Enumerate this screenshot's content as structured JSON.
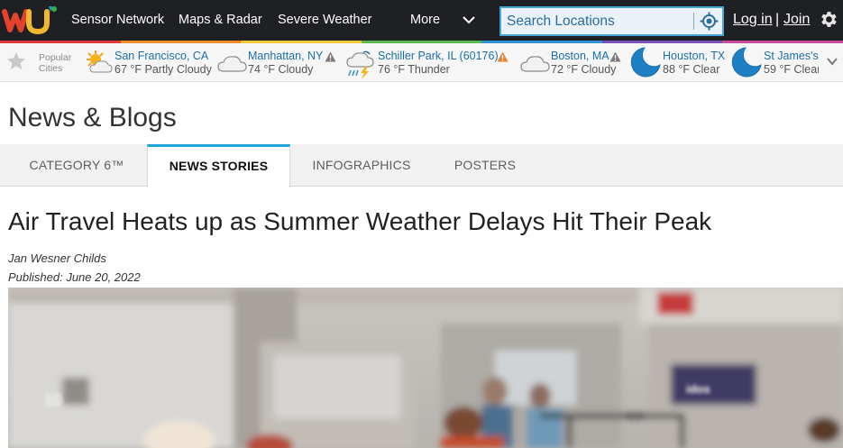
{
  "nav": {
    "links": [
      "Sensor Network",
      "Maps & Radar",
      "Severe Weather",
      "More"
    ],
    "search_placeholder": "Search Locations",
    "login": "Log in",
    "separator": "|",
    "join": "Join"
  },
  "popular": {
    "label_line1": "Popular",
    "label_line2": "Cities",
    "cities": [
      {
        "name": "San Francisco, CA",
        "info": "67 °F Partly Cloudy",
        "icon": "partly-cloudy-icon",
        "alert": false
      },
      {
        "name": "Manhattan, NY",
        "info": "74 °F Cloudy",
        "icon": "cloudy-icon",
        "alert": true,
        "alert_color": "#7a7a7a"
      },
      {
        "name": "Schiller Park, IL (60176)",
        "info": "76 °F Thunder",
        "icon": "thunderstorm-icon",
        "alert": true,
        "alert_color": "#e8802c"
      },
      {
        "name": "Boston, MA",
        "info": "72 °F Cloudy",
        "icon": "cloudy-icon",
        "alert": true,
        "alert_color": "#7a7a7a"
      },
      {
        "name": "Houston, TX",
        "info": "88 °F Clear",
        "icon": "moon-clear-icon",
        "alert": false
      },
      {
        "name": "St James's",
        "info": "59 °F Clear",
        "icon": "moon-clear-icon",
        "alert": false
      }
    ]
  },
  "page": {
    "title": "News & Blogs",
    "tabs": [
      "CATEGORY 6™",
      "NEWS STORIES",
      "INFOGRAPHICS",
      "POSTERS"
    ],
    "active_tab": "NEWS STORIES"
  },
  "article": {
    "headline": "Air Travel Heats up as Summer Weather Delays Hit Their Peak",
    "author": "Jan Wesner Childs",
    "published": "Published: June 20, 2022",
    "photo_sign_text": "idos",
    "photo_gate_number": "10"
  },
  "colors": {
    "nav_bg": "#1e2023",
    "accent": "#1fa6d8",
    "link": "#1a6fa8",
    "rainbow": [
      "#e23a3a",
      "#f08c2a",
      "#f3c93b",
      "#57b84d",
      "#2f93d6",
      "#7b4fb8",
      "#c94b9c"
    ]
  }
}
